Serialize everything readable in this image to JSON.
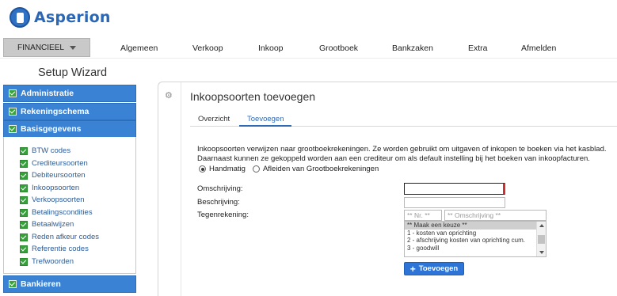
{
  "brand": {
    "name": "Asperion"
  },
  "topnav": {
    "menu_label": "FINANCIEEL",
    "items": [
      "Algemeen",
      "Verkoop",
      "Inkoop",
      "Grootboek",
      "Bankzaken",
      "Extra",
      "Afmelden"
    ]
  },
  "sidebar": {
    "title": "Setup Wizard",
    "sections": [
      "Administratie",
      "Rekeningschema",
      "Basisgegevens",
      "Bankieren"
    ],
    "items": [
      "BTW codes",
      "Crediteursoorten",
      "Debiteursoorten",
      "Inkoopsoorten",
      "Verkoopsoorten",
      "Betalingscondities",
      "Betaalwijzen",
      "Reden afkeur codes",
      "Referentie codes",
      "Trefwoorden"
    ]
  },
  "main": {
    "title": "Inkoopsoorten toevoegen",
    "tabs": [
      "Overzicht",
      "Toevoegen"
    ],
    "active_tab": "Toevoegen",
    "intro": [
      "Inkoopsoorten verwijzen naar grootboekrekeningen. Ze worden gebruikt om uitgaven of inkopen te boeken via het kasblad.",
      "Daarnaast kunnen ze gekoppeld worden aan een crediteur om als default instelling bij het boeken van inkoopfacturen."
    ],
    "radios": {
      "manual": "Handmatig",
      "derive": "Afleiden van Grootboekrekeningen",
      "selected": "Handmatig"
    },
    "form": {
      "omschrijving_label": "Omschrijving:",
      "omschrijving_value": "",
      "beschrijving_label": "Beschrijving:",
      "beschrijving_value": "",
      "tegenrekening_label": "Tegenrekening:",
      "nr_placeholder": "** Nr. **",
      "omschr_placeholder": "** Omschrijving **"
    },
    "options": [
      "** Maak een keuze **",
      "1 - kosten van oprichting",
      "2 - afschrijving kosten van oprichting cum.",
      "3 - goodwill"
    ],
    "selected_option": "** Maak een keuze **",
    "add_button": "Toevoegen"
  },
  "colors": {
    "accent": "#2d74d6",
    "sidebar_header": "#3a82d4",
    "check": "#36a03a",
    "required": "#d32f2f"
  }
}
